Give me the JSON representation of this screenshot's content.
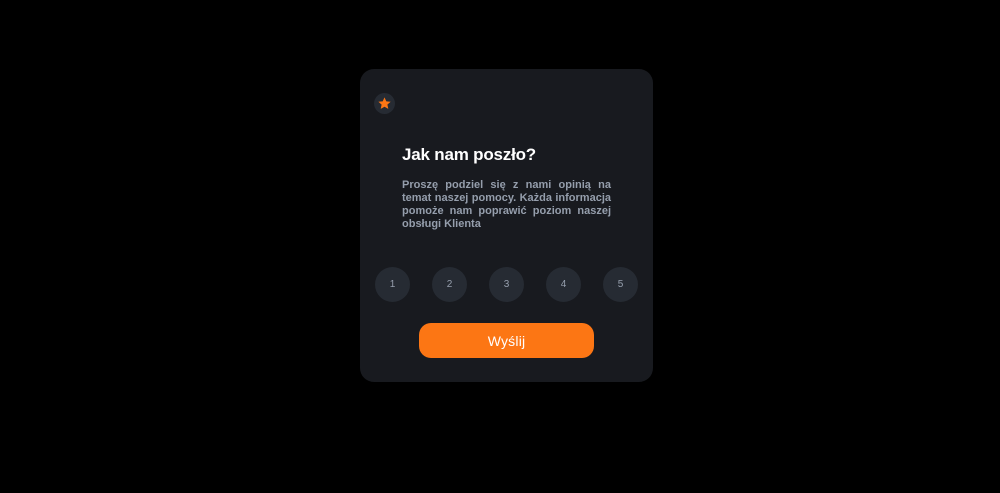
{
  "card": {
    "icon": "star-icon",
    "title": "Jak nam poszło?",
    "description": "Proszę podziel się z nami opinią na temat naszej pomocy. Każda informacja pomoże nam poprawić poziom naszej obsługi Klienta",
    "ratings": [
      "1",
      "2",
      "3",
      "4",
      "5"
    ],
    "submit_label": "Wyślij"
  },
  "colors": {
    "background": "#000000",
    "card": "#181a1f",
    "accent": "#fc7614",
    "rating_bg": "#262b33",
    "muted_text": "#959eac"
  }
}
